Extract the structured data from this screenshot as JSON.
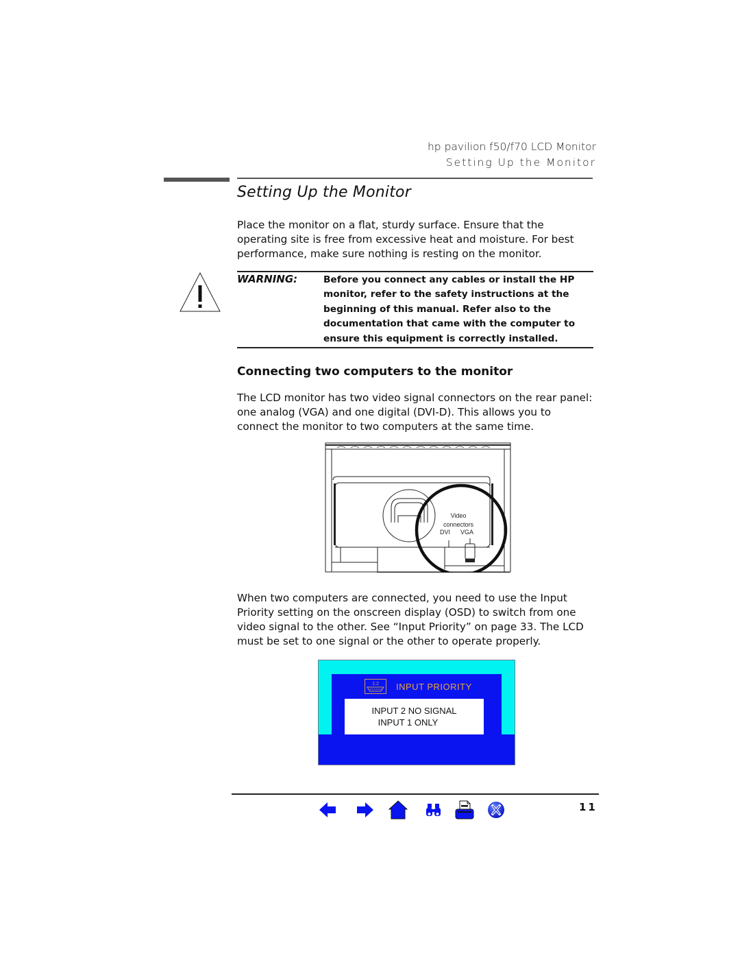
{
  "running_head": {
    "product": "hp pavilion f50/f70 LCD Monitor",
    "section": "Setting Up the Monitor"
  },
  "section_title": "Setting Up the Monitor",
  "intro_paragraph": "Place the monitor on a flat, sturdy surface. Ensure that the operating site is free from excessive heat and moisture. For best performance, make sure nothing is resting on the monitor.",
  "warning": {
    "icon": "warning-triangle-icon",
    "label": "WARNING:",
    "text": "Before you connect any cables or install the HP monitor, refer to the safety instructions at the beginning of this manual. Refer also to the documentation that came with the computer to ensure this equipment is correctly installed."
  },
  "subsection": {
    "title": "Connecting two computers to the monitor",
    "paragraph": "The LCD monitor has two video signal connectors on the rear panel: one analog (VGA) and one digital (DVI-D). This allows you to connect the monitor to two computers at the same time."
  },
  "diagram": {
    "callout_line1": "Video",
    "callout_line2": "connectors",
    "label_dvi": "DVI",
    "label_vga": "VGA"
  },
  "osd_paragraph": "When two computers are connected, you need to use the Input Priority setting on the onscreen display (OSD) to switch from one video signal to the other. See “Input Priority” on page 33. The LCD must be set to one signal or the other to operate properly.",
  "osd": {
    "icon": "input-priority-icon",
    "icon_text": "1:2",
    "title": "INPUT PRIORITY",
    "line1": "INPUT 2 NO SIGNAL",
    "line2": "INPUT 1 ONLY",
    "colors": {
      "frame": "#00f3f0",
      "panel": "#0a14f0",
      "title": "#e8a53a"
    }
  },
  "footer": {
    "nav_icons": [
      "previous-page-icon",
      "next-page-icon",
      "home-icon",
      "search-icon",
      "print-icon",
      "exit-icon"
    ],
    "nav_color": "#0a14f0",
    "page_number": "11"
  }
}
